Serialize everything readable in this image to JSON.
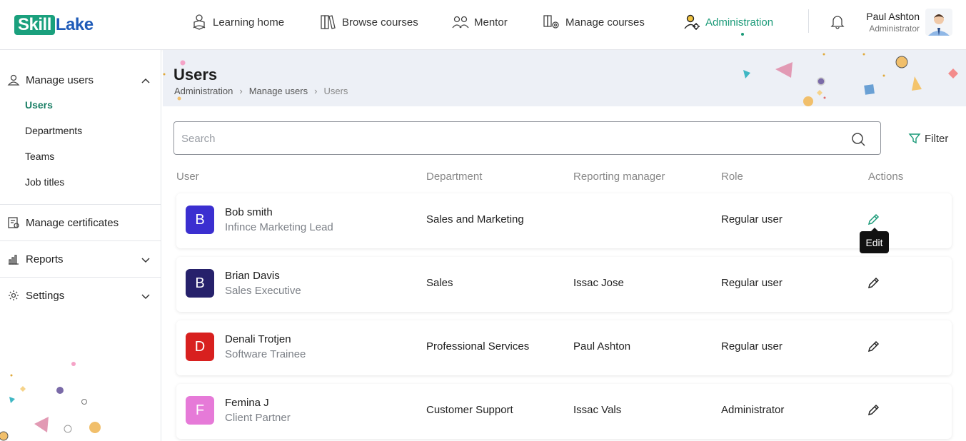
{
  "brand": {
    "logo_left": "Skill",
    "logo_right": "Lake"
  },
  "nav": [
    {
      "label": "Learning home",
      "icon": "learning-home-icon"
    },
    {
      "label": "Browse courses",
      "icon": "books-icon"
    },
    {
      "label": "Mentor",
      "icon": "mentor-icon"
    },
    {
      "label": "Manage courses",
      "icon": "manage-courses-icon"
    },
    {
      "label": "Administration",
      "icon": "admin-user-icon",
      "active": true
    }
  ],
  "user": {
    "name": "Paul Ashton",
    "role": "Administrator"
  },
  "sidebar": {
    "manage_users": {
      "label": "Manage users",
      "expanded": true,
      "items": [
        {
          "label": "Users",
          "active": true
        },
        {
          "label": "Departments"
        },
        {
          "label": "Teams"
        },
        {
          "label": "Job titles"
        }
      ]
    },
    "manage_certificates": "Manage certificates",
    "reports": "Reports",
    "settings": "Settings"
  },
  "page": {
    "title": "Users",
    "breadcrumb": [
      "Administration",
      "Manage users",
      "Users"
    ],
    "search_placeholder": "Search",
    "filter_label": "Filter"
  },
  "table": {
    "columns": [
      "User",
      "Department",
      "Reporting manager",
      "Role",
      "Actions"
    ],
    "rows": [
      {
        "initial": "B",
        "name": "Bob smith",
        "job_title": "Infince Marketing Lead",
        "department": "Sales and Marketing",
        "manager": "",
        "role": "Regular user",
        "avatar_color": "#3b2fd0"
      },
      {
        "initial": "B",
        "name": "Brian Davis",
        "job_title": "Sales Executive",
        "department": "Sales",
        "manager": "Issac Jose",
        "role": "Regular user",
        "avatar_color": "#26216b"
      },
      {
        "initial": "D",
        "name": "Denali Trotjen",
        "job_title": "Software Trainee",
        "department": "Professional Services",
        "manager": "Paul Ashton",
        "role": "Regular user",
        "avatar_color": "#d8201f"
      },
      {
        "initial": "F",
        "name": "Femina J",
        "job_title": "Client Partner",
        "department": "Customer Support",
        "manager": "Issac Vals",
        "role": "Administrator",
        "avatar_color": "#e67ad8"
      }
    ],
    "tooltip": "Edit"
  },
  "colors": {
    "accent": "#1a9a78",
    "brand_blue": "#1e5bb8",
    "hero_bg": "#edf0f6"
  }
}
